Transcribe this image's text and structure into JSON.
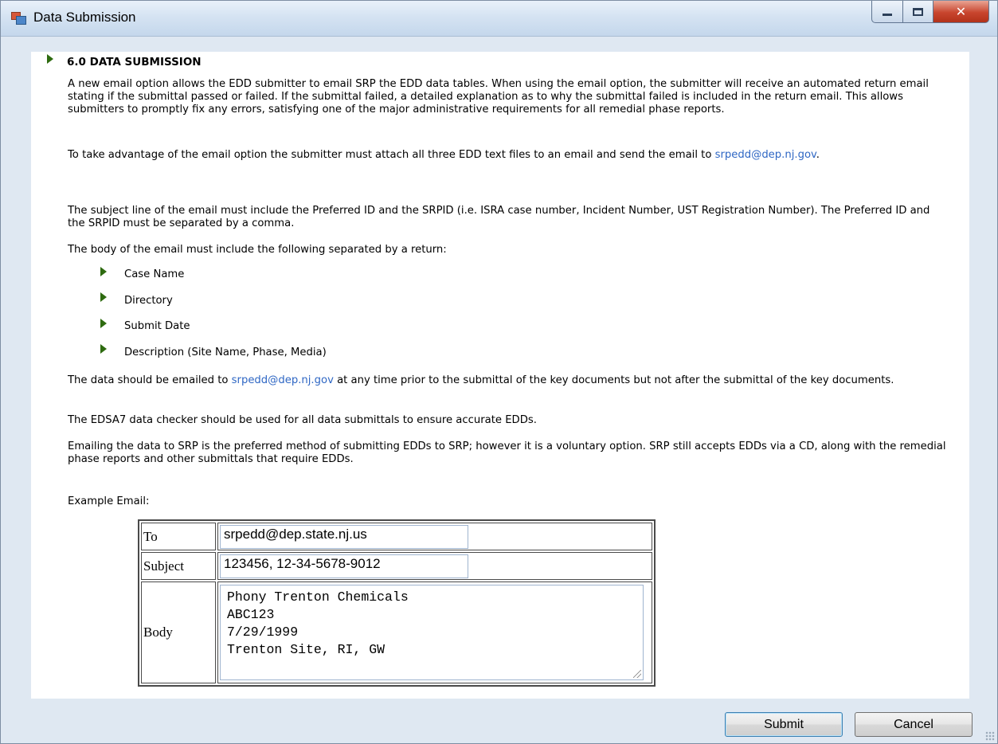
{
  "window": {
    "title": "Data Submission",
    "buttons": {
      "minimize": "minimize",
      "maximize": "maximize",
      "close": "close"
    }
  },
  "doc": {
    "heading": "6.0 DATA SUBMISSION",
    "p1": "A new email option allows the EDD submitter to email SRP the EDD data tables. When using the email option, the submitter will receive an automated return email stating if the submittal passed or failed. If the submittal failed, a detailed explanation as to why the submittal failed is included in the return email. This allows submitters to promptly fix any errors, satisfying one of the major administrative requirements for all remedial phase reports.",
    "p2_before": "To take advantage of the email option the submitter must attach all three EDD text files to an email and send the email to ",
    "p2_link": "srpedd@dep.nj.gov",
    "p2_after": ".",
    "p3": "The subject line of the email must include the Preferred ID and the SRPID (i.e. ISRA case number, Incident Number, UST Registration Number). The Preferred ID and the SRPID must be separated by a comma.",
    "p4": "The body of the email must include the following separated by a return:",
    "bullets": [
      "Case Name",
      "Directory",
      "Submit Date",
      "Description (Site Name, Phase, Media)"
    ],
    "p5_before": "The data should be emailed to ",
    "p5_link": "srpedd@dep.nj.gov",
    "p5_after": " at any time prior to the submittal of the key documents but not after the submittal of the key documents.",
    "p6": "The EDSA7 data checker should be used for all data submittals to ensure accurate EDDs.",
    "p7": "Emailing the data to SRP is the preferred method of submitting EDDs to SRP; however it is a voluntary option. SRP still accepts EDDs via a CD, along with the remedial phase reports and other submittals that require EDDs.",
    "p8": "Example Email:"
  },
  "example_email": {
    "to_label": "To",
    "to_value": "srpedd@dep.state.nj.us",
    "subject_label": "Subject",
    "subject_value": "123456, 12-34-5678-9012",
    "body_label": "Body",
    "body_value": "Phony Trenton Chemicals\nABC123\n7/29/1999\nTrenton Site, RI, GW"
  },
  "actions": {
    "submit": "Submit",
    "cancel": "Cancel"
  },
  "colors": {
    "link": "#2f67c4",
    "bullet": "#2e6b10",
    "window_frame": "#dfe8f2"
  }
}
